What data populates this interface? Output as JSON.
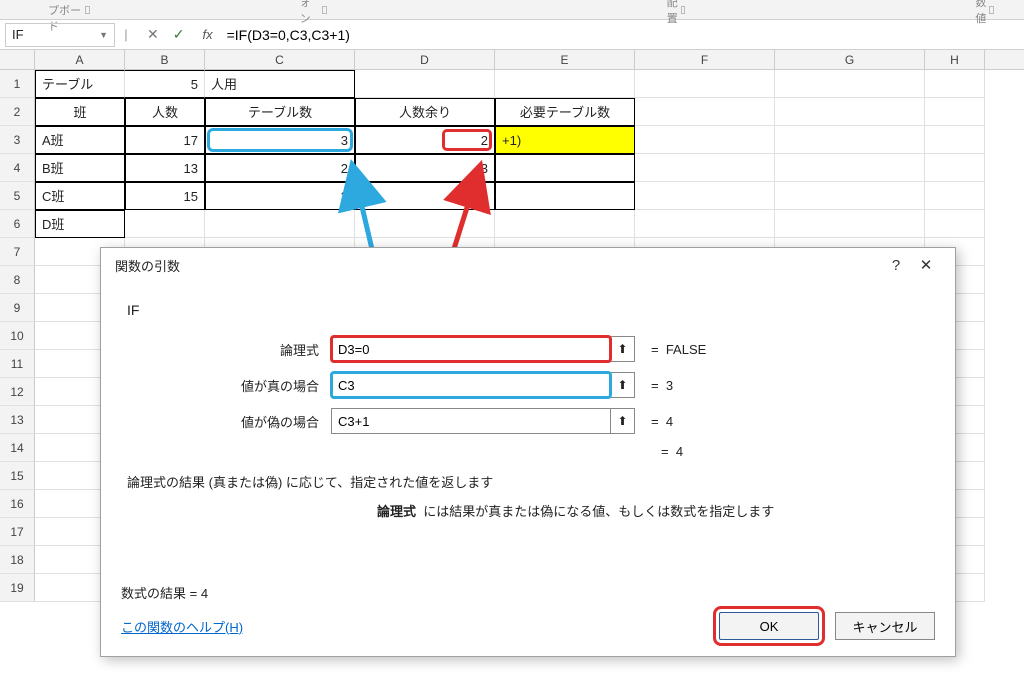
{
  "ribbon": {
    "g1": "クリップボード",
    "g2": "フォント",
    "g3": "配置",
    "g4": "数値"
  },
  "fbar": {
    "namebox": "IF",
    "fx": "fx",
    "formula": "=IF(D3=0,C3,C3+1)"
  },
  "cols": [
    "A",
    "B",
    "C",
    "D",
    "E",
    "F",
    "G",
    "H"
  ],
  "rows": [
    "1",
    "2",
    "3",
    "4",
    "5",
    "6",
    "7",
    "8",
    "9",
    "10",
    "11",
    "12",
    "13",
    "14",
    "15",
    "16",
    "17",
    "18",
    "19"
  ],
  "sheet": {
    "r1": {
      "A": "テーブル",
      "B": "5",
      "C": "人用"
    },
    "r2": {
      "A": "班",
      "B": "人数",
      "C": "テーブル数",
      "D": "人数余り",
      "E": "必要テーブル数"
    },
    "r3": {
      "A": "A班",
      "B": "17",
      "C": "3",
      "D": "2",
      "E": "+1)"
    },
    "r4": {
      "A": "B班",
      "B": "13",
      "C": "2",
      "D": "3"
    },
    "r5": {
      "A": "C班",
      "B": "15",
      "C": "3",
      "D": "0"
    },
    "r6": {
      "A": "D班"
    }
  },
  "dialog": {
    "title": "関数の引数",
    "help": "?",
    "close": "✕",
    "fn": "IF",
    "arg1": {
      "label": "論理式",
      "value": "D3=0",
      "result": "FALSE"
    },
    "arg2": {
      "label": "値が真の場合",
      "value": "C3",
      "result": "3"
    },
    "arg3": {
      "label": "値が偽の場合",
      "value": "C3+1",
      "result": "4"
    },
    "eq": "=",
    "overall": "4",
    "desc1": "論理式の結果 (真または偽) に応じて、指定された値を返します",
    "desc2a": "論理式",
    "desc2b": "には結果が真または偽になる値、もしくは数式を指定します",
    "resultLabel": "数式の結果 = ",
    "resultVal": "4",
    "helplink": "この関数のヘルプ(H)",
    "ok": "OK",
    "cancel": "キャンセル"
  }
}
